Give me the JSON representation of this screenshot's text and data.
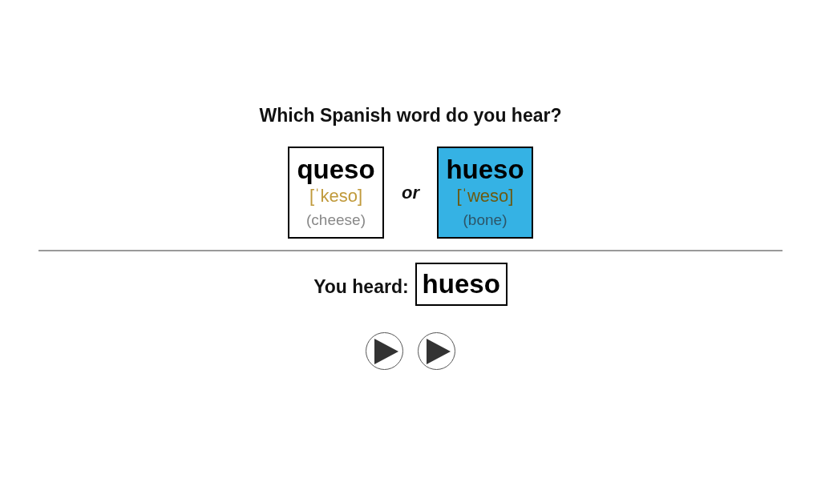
{
  "question": "Which Spanish word do you hear?",
  "choices": [
    {
      "word": "queso",
      "ipa": "[ˈkeso]",
      "meaning": "(cheese)",
      "selected": false
    },
    {
      "word": "hueso",
      "ipa": "[ˈweso]",
      "meaning": "(bone)",
      "selected": true
    }
  ],
  "separator": "or",
  "answer": {
    "label": "You heard:",
    "word": "hueso"
  },
  "play_buttons": [
    {
      "kind": "play"
    },
    {
      "kind": "play"
    }
  ]
}
